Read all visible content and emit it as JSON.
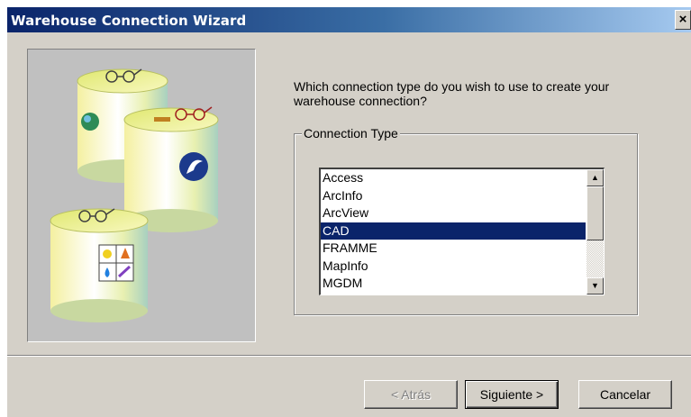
{
  "window": {
    "title": "Warehouse Connection Wizard",
    "close_label": "×"
  },
  "wizard": {
    "question": "Which connection type do you wish to use to create your warehouse connection?",
    "group_label": "Connection Type",
    "connection_types": [
      "Access",
      "ArcInfo",
      "ArcView",
      "CAD",
      "FRAMME",
      "MapInfo",
      "MGDM"
    ],
    "selected": "CAD"
  },
  "scrollbar": {
    "up_arrow": "▲",
    "down_arrow": "▼"
  },
  "buttons": {
    "back_label": "< Atrás",
    "next_label": "Siguiente >",
    "cancel_label": "Cancelar"
  },
  "colors": {
    "title_bar": "#0a246a",
    "face": "#d4d0c8",
    "selection": "#0a246a"
  }
}
